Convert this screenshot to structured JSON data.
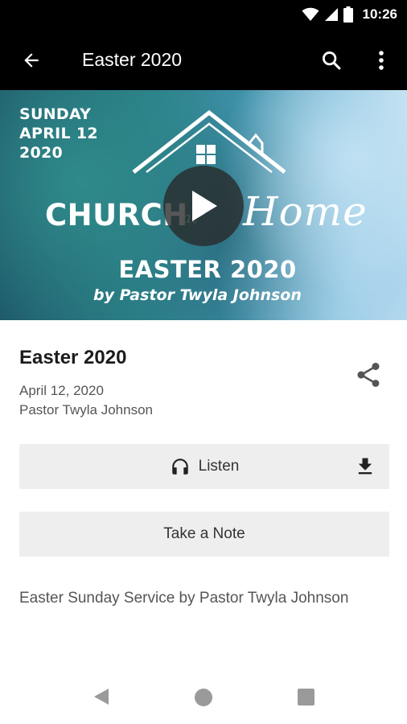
{
  "status_bar": {
    "time": "10:26"
  },
  "app_bar": {
    "title": "Easter 2020"
  },
  "banner": {
    "date_lines": [
      "SUNDAY",
      "APRIL 12",
      "2020"
    ],
    "church_text": "CHURCH",
    "at_text": "at",
    "home_text": "Home",
    "title": "EASTER 2020",
    "byline": "by  Pastor Twyla Johnson"
  },
  "sermon": {
    "title": "Easter 2020",
    "date": "April 12, 2020",
    "speaker": "Pastor Twyla Johnson",
    "description": "Easter Sunday Service by Pastor Twyla Johnson"
  },
  "actions": {
    "listen_label": "Listen",
    "note_label": "Take a Note"
  },
  "icons": {
    "back": "arrow-back-icon",
    "search": "search-icon",
    "more": "more-vert-icon",
    "play": "play-icon",
    "share": "share-icon",
    "headphones": "headphones-icon",
    "download": "download-icon"
  }
}
